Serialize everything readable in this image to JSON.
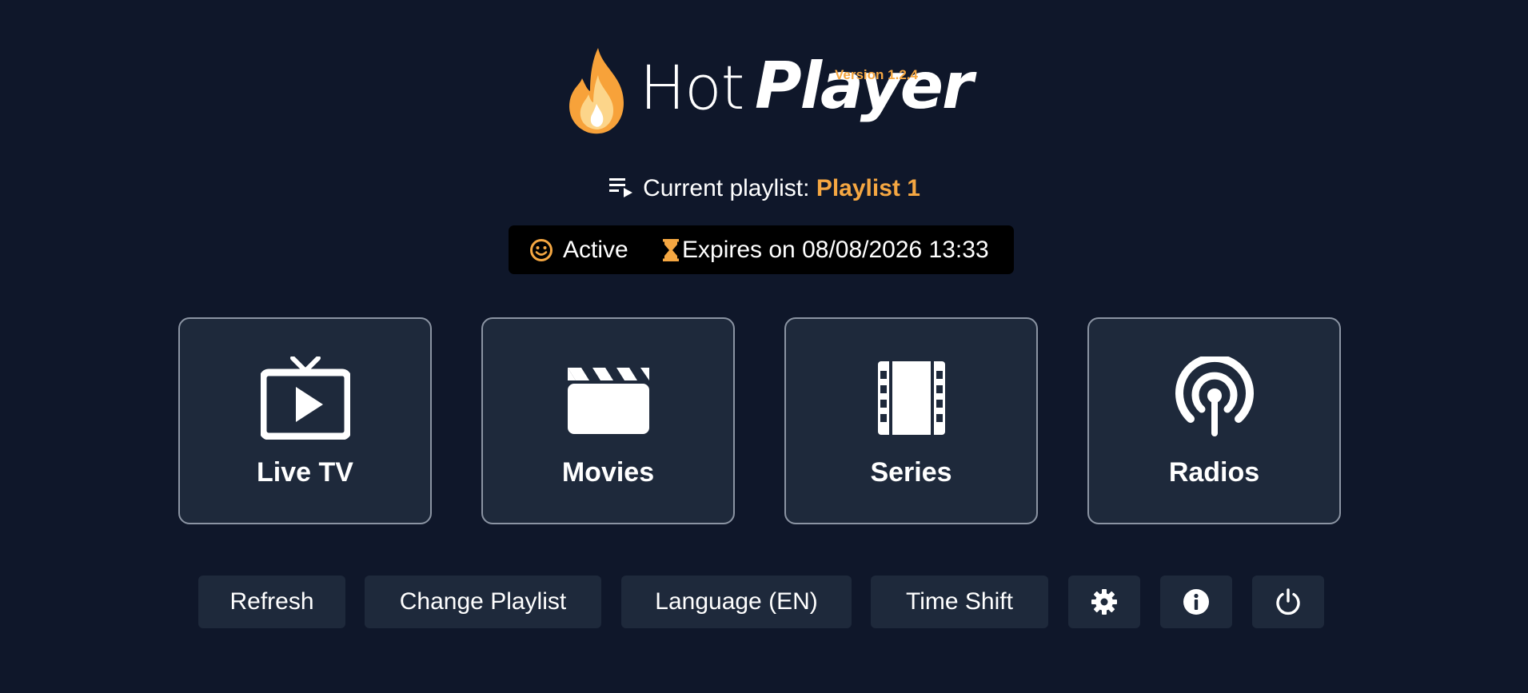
{
  "app": {
    "name_light": "Hot",
    "name_bold": "Player",
    "version": "Version 1.2.4"
  },
  "playlist": {
    "label": "Current playlist:",
    "name": "Playlist 1",
    "icon": "playlist-play-icon"
  },
  "status": {
    "state": "Active",
    "state_icon": "smile-icon",
    "expiry": "Expires on 08/08/2026 13:33",
    "expiry_icon": "hourglass-icon"
  },
  "menu": [
    {
      "label": "Live TV",
      "icon": "tv-icon"
    },
    {
      "label": "Movies",
      "icon": "clapperboard-icon"
    },
    {
      "label": "Series",
      "icon": "film-strip-icon"
    },
    {
      "label": "Radios",
      "icon": "broadcast-icon"
    }
  ],
  "actions": {
    "refresh": "Refresh",
    "change_playlist": "Change Playlist",
    "language": "Language (EN)",
    "time_shift": "Time Shift",
    "settings_icon": "gear-icon",
    "info_icon": "info-icon",
    "power_icon": "power-icon"
  },
  "colors": {
    "background": "#0f172a",
    "card": "#1e293b",
    "accent": "#f5a742",
    "status_bg": "#000000"
  }
}
